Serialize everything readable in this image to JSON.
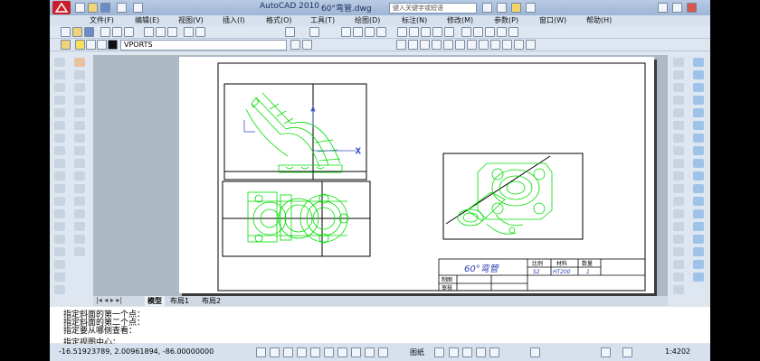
{
  "title": {
    "app": "AutoCAD 2010",
    "file": "60°弯管.dwg",
    "search_placeholder": "键入关键字或短语"
  },
  "menu": [
    "文件(F)",
    "编辑(E)",
    "视图(V)",
    "插入(I)",
    "格式(O)",
    "工具(T)",
    "绘图(D)",
    "标注(N)",
    "修改(M)",
    "参数(P)",
    "窗口(W)",
    "帮助(H)"
  ],
  "layer": {
    "name": "VPORTS"
  },
  "tabs": {
    "model": "模型",
    "layout1": "布局1",
    "layout2": "布局2"
  },
  "command_lines": [
    "指定斜面的第一个点：",
    "指定斜面的第二个点：",
    "指定要从哪侧查看：",
    "指定视图中心："
  ],
  "status": {
    "coords": "-16.51923789, 2.00961894, -86.00000000",
    "mode": "图纸",
    "scale": "1:4202"
  },
  "title_block": {
    "name": "60°弯管",
    "col_scale": "比例",
    "col_material": "材料",
    "col_qty": "数量",
    "scale": "S2",
    "material": "HT200",
    "qty": "1",
    "row_draw": "制图",
    "row_check": "审核"
  },
  "colors": {
    "geometry": "#00dd00",
    "frame": "#000000",
    "paper": "#ffffff"
  }
}
